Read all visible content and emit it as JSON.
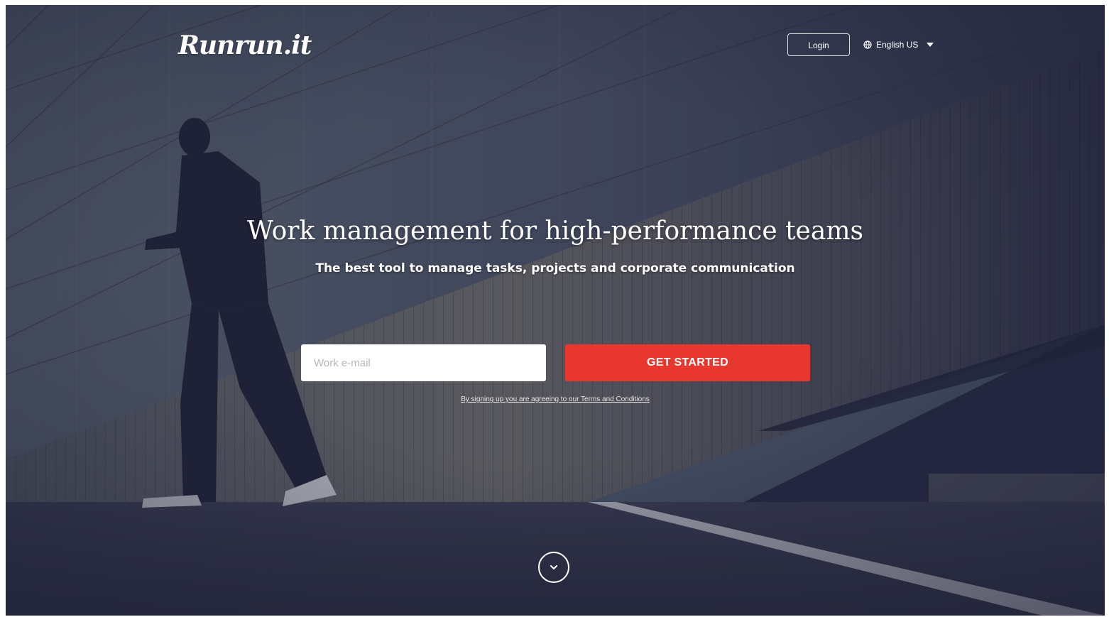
{
  "header": {
    "logo_text": "Runrun.it",
    "login_label": "Login",
    "language": {
      "selected": "English US",
      "icon": "globe-icon"
    }
  },
  "hero": {
    "title": "Work management for high-performance teams",
    "subtitle": "The best tool to manage tasks, projects and corporate communication",
    "email_input": {
      "placeholder": "Work e-mail",
      "value": ""
    },
    "cta_label": "GET STARTED",
    "terms_text": "By signing up you are agreeing to our Terms and Conditions",
    "scroll_icon": "chevron-down-icon"
  },
  "colors": {
    "accent": "#e8372e",
    "overlay": "#2a2d42",
    "text": "#ffffff"
  }
}
